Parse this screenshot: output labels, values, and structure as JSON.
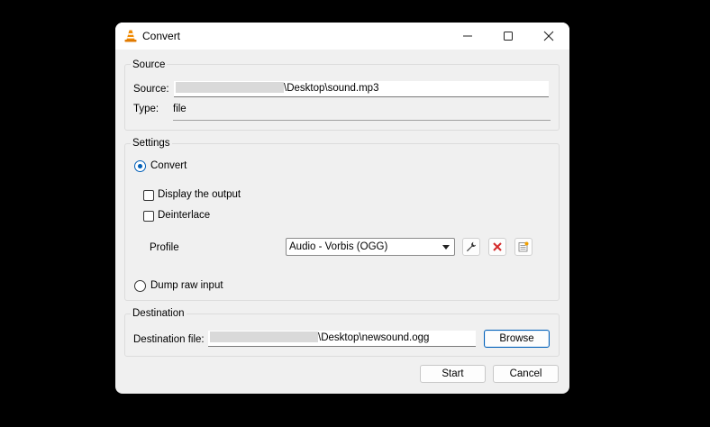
{
  "window": {
    "title": "Convert",
    "icon": "vlc-cone-icon",
    "controls": [
      "minimize-icon",
      "maximize-icon",
      "close-icon"
    ]
  },
  "source": {
    "group_label": "Source",
    "source_label": "Source:",
    "source_path_suffix": "\\Desktop\\sound.mp3",
    "type_label": "Type:",
    "type_value": "file"
  },
  "settings": {
    "group_label": "Settings",
    "convert_label": "Convert",
    "convert_selected": true,
    "display_output_label": "Display the output",
    "display_output_checked": false,
    "deinterlace_label": "Deinterlace",
    "deinterlace_checked": false,
    "profile_label": "Profile",
    "profile_value": "Audio - Vorbis (OGG)",
    "profile_buttons": [
      "wrench-icon",
      "delete-icon",
      "new-profile-icon"
    ],
    "dump_raw_label": "Dump raw input",
    "dump_raw_selected": false
  },
  "destination": {
    "group_label": "Destination",
    "file_label": "Destination file:",
    "file_path_suffix": "\\Desktop\\newsound.ogg",
    "browse_label": "Browse"
  },
  "footer": {
    "start_label": "Start",
    "cancel_label": "Cancel"
  },
  "colors": {
    "accent": "#005fb8",
    "delete_red": "#d42a2a",
    "vlc_orange": "#f08a00"
  }
}
